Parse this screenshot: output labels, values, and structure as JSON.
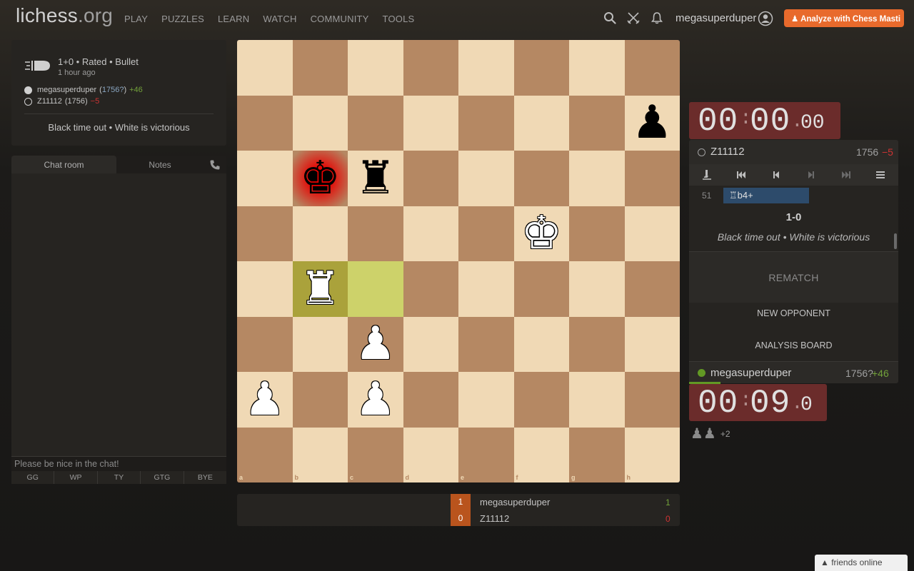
{
  "header": {
    "logo": "lichess",
    "logo_suffix": ".org",
    "nav": [
      "PLAY",
      "PUZZLES",
      "LEARN",
      "WATCH",
      "COMMUNITY",
      "TOOLS"
    ],
    "username": "megasuperduper",
    "analyze_label": "♟ Analyze with Chess Masti"
  },
  "game_info": {
    "type": "1+0 • Rated • Bullet",
    "time_ago": "1 hour ago",
    "white_name": "megasuperduper",
    "white_rating": "1756?",
    "white_diff": "+46",
    "black_name": "Z11112",
    "black_rating": "(1756)",
    "black_diff": "−5",
    "status": "Black time out • White is victorious"
  },
  "chat": {
    "tab_chat": "Chat room",
    "tab_notes": "Notes",
    "placeholder": "Please be nice in the chat!",
    "presets": [
      "GG",
      "WP",
      "TY",
      "GTG",
      "BYE"
    ]
  },
  "board": {
    "files": [
      "a",
      "b",
      "c",
      "d",
      "e",
      "f",
      "g",
      "h"
    ],
    "ranks": [
      "8",
      "7",
      "6",
      "5",
      "4",
      "3",
      "2",
      "1"
    ],
    "last_move": [
      "c4",
      "b4"
    ],
    "check": "b6",
    "pieces": [
      {
        "sq": "h7",
        "glyph": "♟",
        "color": "black",
        "name": "black-pawn"
      },
      {
        "sq": "b6",
        "glyph": "♚",
        "color": "black",
        "name": "black-king"
      },
      {
        "sq": "c6",
        "glyph": "♜",
        "color": "black",
        "name": "black-rook"
      },
      {
        "sq": "f5",
        "glyph": "♚",
        "color": "white",
        "name": "white-king"
      },
      {
        "sq": "b4",
        "glyph": "♜",
        "color": "white",
        "name": "white-rook"
      },
      {
        "sq": "c3",
        "glyph": "♟",
        "color": "white",
        "name": "white-pawn"
      },
      {
        "sq": "a2",
        "glyph": "♟",
        "color": "white",
        "name": "white-pawn"
      },
      {
        "sq": "c2",
        "glyph": "♟",
        "color": "white",
        "name": "white-pawn"
      }
    ]
  },
  "scoreboard": {
    "rows": [
      {
        "score": "1",
        "name": "megasuperduper",
        "result": "1",
        "color": "#72a13a"
      },
      {
        "score": "0",
        "name": "Z11112",
        "result": "0",
        "color": "#cc3333"
      }
    ]
  },
  "clocks": {
    "top": {
      "mm": "00",
      "ss": "00",
      "frac": "00"
    },
    "bottom": {
      "mm": "00",
      "ss": "09",
      "frac": "0"
    }
  },
  "right_panel": {
    "opponent_name": "Z11112",
    "opponent_rating": "1756",
    "opponent_diff": "−5",
    "move_number": "51",
    "current_move": "♖b4+",
    "result": "1-0",
    "result_text": "Black time out • White is victorious",
    "rematch": "REMATCH",
    "new_opponent": "NEW OPPONENT",
    "analysis_board": "ANALYSIS BOARD",
    "me_name": "megasuperduper",
    "me_rating": "1756?",
    "me_diff": "+46"
  },
  "material": {
    "pieces": "♟♟",
    "diff": "+2"
  },
  "friends": "friends online",
  "colors": {
    "accent": "#e86a2c",
    "light_sq": "#f0d9b5",
    "dark_sq": "#b58863",
    "clock_bg": "#6b2c2b",
    "win": "#72a13a",
    "loss": "#cc3333"
  }
}
